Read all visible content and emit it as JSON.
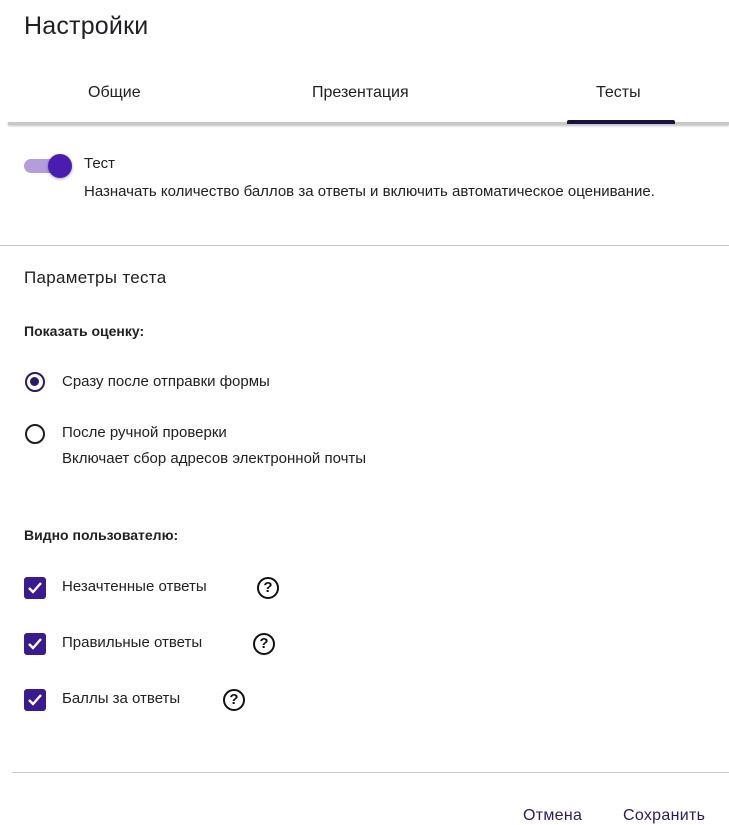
{
  "dialog": {
    "title": "Настройки"
  },
  "tabs": [
    {
      "label": "Общие",
      "active": false
    },
    {
      "label": "Презентация",
      "active": false
    },
    {
      "label": "Тесты",
      "active": true
    }
  ],
  "quiz_toggle": {
    "label": "Тест",
    "description": "Назначать количество баллов за ответы и включить автоматическое оценивание.",
    "enabled": true
  },
  "quiz_options": {
    "title": "Параметры теста",
    "show_grade": {
      "heading": "Показать оценку:",
      "options": [
        {
          "label": "Сразу после отправки формы",
          "sublabel": "",
          "selected": true
        },
        {
          "label": "После ручной проверки",
          "sublabel": "Включает сбор адресов электронной почты",
          "selected": false
        }
      ]
    },
    "visible_to_user": {
      "heading": "Видно пользователю:",
      "options": [
        {
          "label": "Незачтенные ответы",
          "checked": true,
          "help_icon": "?"
        },
        {
          "label": "Правильные ответы",
          "checked": true,
          "help_icon": "?"
        },
        {
          "label": "Баллы за ответы",
          "checked": true,
          "help_icon": "?"
        }
      ]
    }
  },
  "footer": {
    "cancel_label": "Отмена",
    "save_label": "Сохранить"
  },
  "colors": {
    "accent": "#2c1a66",
    "toggle_thumb": "#4a1db0",
    "toggle_track": "#b39ddb",
    "divider": "#c8c8c8"
  }
}
